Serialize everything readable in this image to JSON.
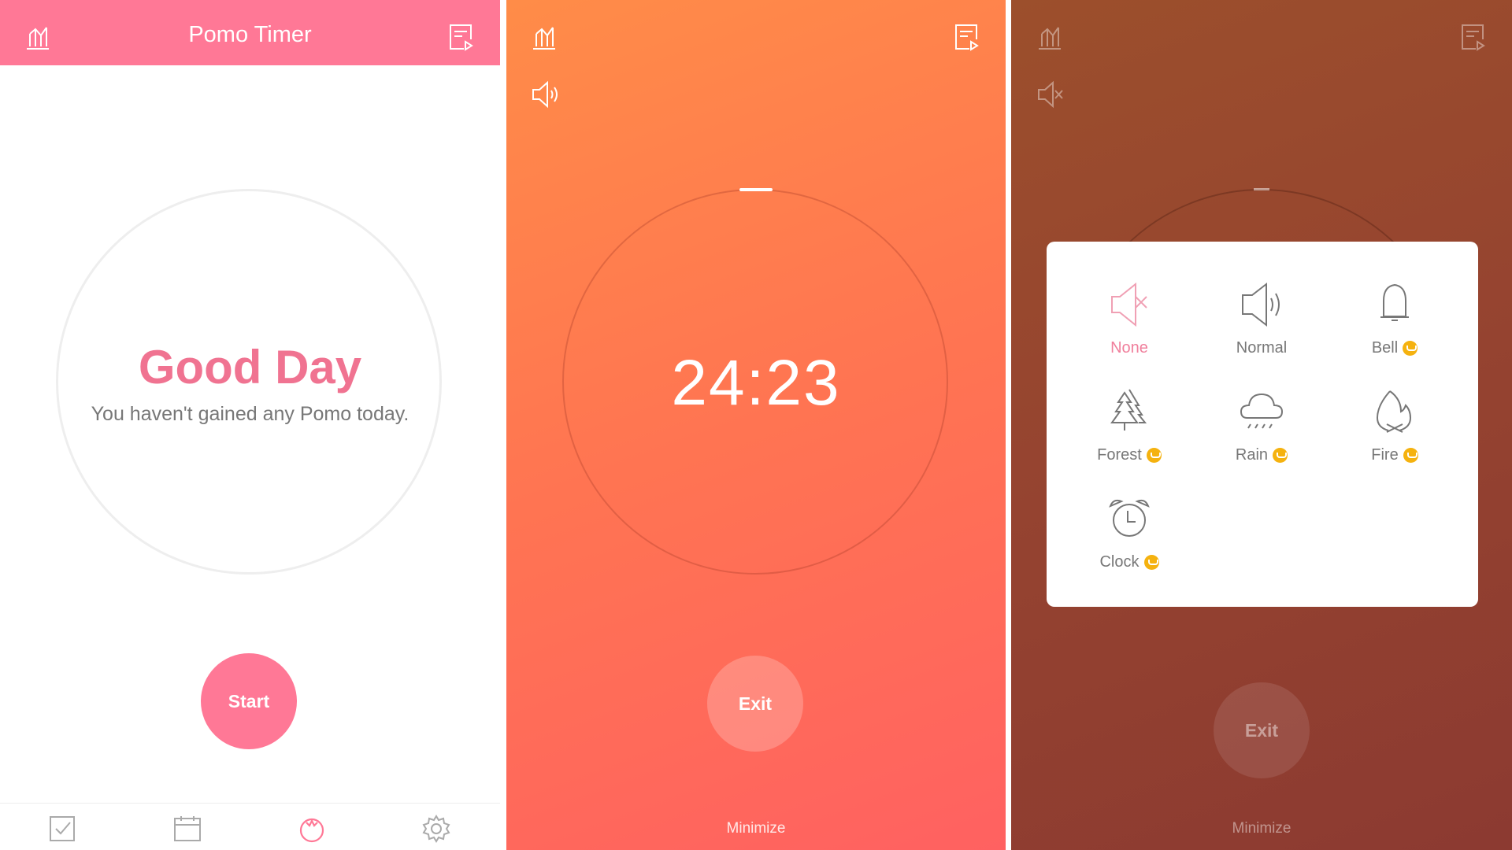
{
  "screen1": {
    "header": {
      "title": "Pomo Timer",
      "left_icon": "chart-icon",
      "right_icon": "playlist-icon"
    },
    "greeting": "Good Day",
    "subtitle": "You haven't gained any Pomo today.",
    "start_label": "Start",
    "nav": [
      {
        "icon": "checkbox-icon",
        "active": false
      },
      {
        "icon": "calendar-icon",
        "active": false
      },
      {
        "icon": "tomato-icon",
        "active": true
      },
      {
        "icon": "gear-icon",
        "active": false
      }
    ]
  },
  "screen2": {
    "timer": "24:23",
    "exit_label": "Exit",
    "minimize_label": "Minimize",
    "sound_icon": "speaker-icon"
  },
  "screen3": {
    "exit_label": "Exit",
    "minimize_label": "Minimize",
    "sound_icon": "speaker-muted-icon",
    "sound_options": [
      {
        "label": "None",
        "icon": "speaker-muted-icon",
        "selected": true,
        "premium": false
      },
      {
        "label": "Normal",
        "icon": "speaker-icon",
        "selected": false,
        "premium": false
      },
      {
        "label": "Bell",
        "icon": "bell-icon",
        "selected": false,
        "premium": true
      },
      {
        "label": "Forest",
        "icon": "forest-icon",
        "selected": false,
        "premium": true
      },
      {
        "label": "Rain",
        "icon": "rain-icon",
        "selected": false,
        "premium": true
      },
      {
        "label": "Fire",
        "icon": "fire-icon",
        "selected": false,
        "premium": true
      },
      {
        "label": "Clock",
        "icon": "alarm-clock-icon",
        "selected": false,
        "premium": true
      }
    ]
  },
  "colors": {
    "primary_pink": "#ff7896",
    "timer_orange": "#ff7a4e",
    "popup_selected": "#f07f9c",
    "premium": "#f5b20f"
  }
}
